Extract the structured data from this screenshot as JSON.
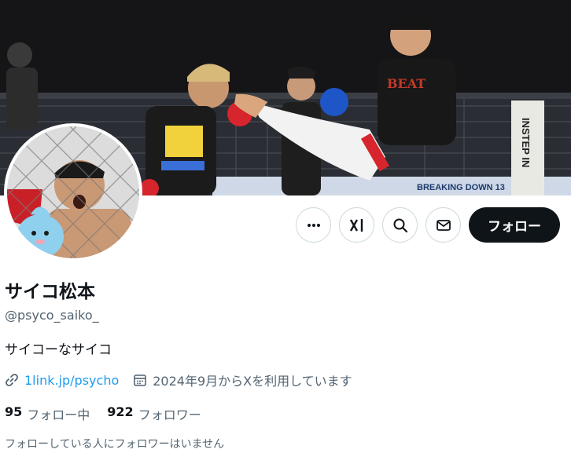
{
  "banner": {
    "sign_text": "INSTEP IN",
    "ring_text": "BREAKING DOWN 13"
  },
  "actions": {
    "more_icon": "more-icon",
    "grok_icon": "grok-icon",
    "search_icon": "search-icon",
    "message_icon": "mail-icon",
    "follow_label": "フォロー"
  },
  "profile": {
    "display_name": "サイコ松本",
    "handle": "@psyco_saiko_",
    "bio": "サイコーなサイコ",
    "link_text": "1link.jp/psycho",
    "joined_text": "2024年9月からXを利用しています"
  },
  "stats": {
    "following_count": "95",
    "following_label": "フォロー中",
    "followers_count": "922",
    "followers_label": "フォロワー"
  },
  "note": "フォローしている人にフォロワーはいません",
  "colors": {
    "accent": "#1d9bf0",
    "text": "#0f1419",
    "muted": "#536471",
    "border": "#cfd9de"
  }
}
